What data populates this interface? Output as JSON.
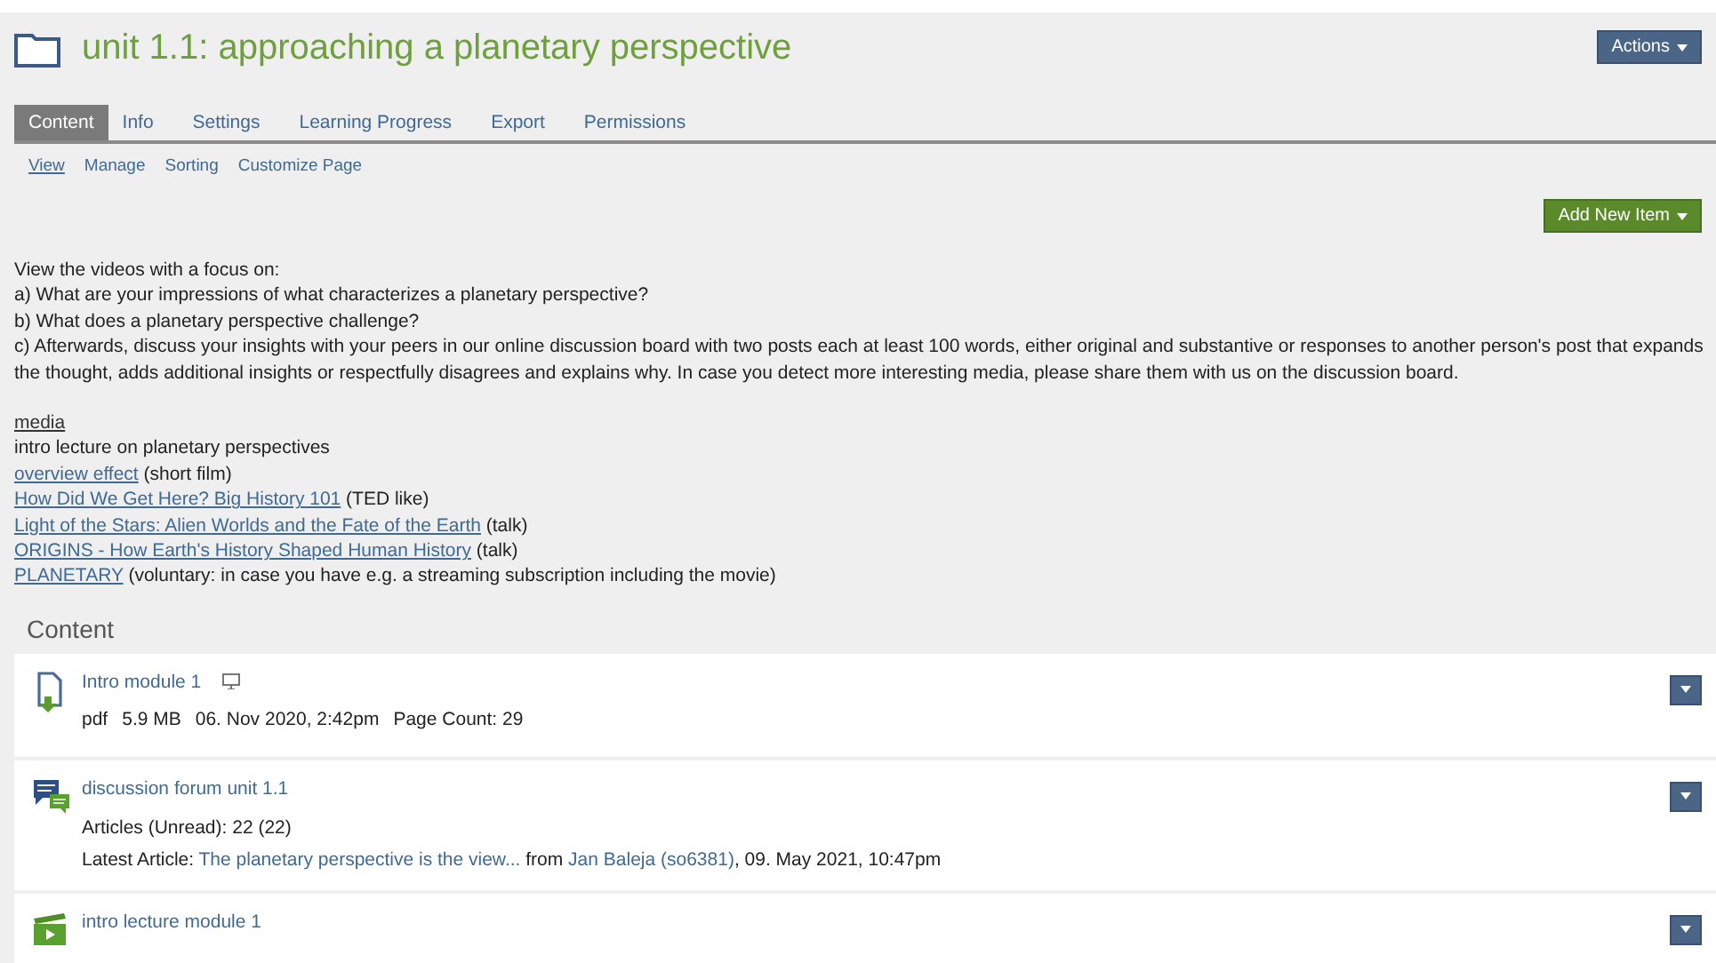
{
  "title": "unit 1.1: approaching a planetary perspective",
  "actions_button": "Actions",
  "tabs": [
    {
      "label": "Content",
      "selected": true
    },
    {
      "label": "Info",
      "selected": false
    },
    {
      "label": "Settings",
      "selected": false
    },
    {
      "label": "Learning Progress",
      "selected": false
    },
    {
      "label": "Export",
      "selected": false
    },
    {
      "label": "Permissions",
      "selected": false
    }
  ],
  "subtabs": [
    {
      "label": "View",
      "selected": true
    },
    {
      "label": "Manage",
      "selected": false
    },
    {
      "label": "Sorting",
      "selected": false
    },
    {
      "label": "Customize Page",
      "selected": false
    }
  ],
  "add_button": "Add New Item",
  "description": [
    "View the videos with a focus on:",
    "a) What are your impressions of what characterizes a planetary perspective?",
    "b) What does a planetary perspective challenge?",
    "c) Afterwards, discuss your insights with your peers in our online discussion board with two posts each at least 100 words, either original and substantive or responses to another person's post that expands the thought, adds additional insights or respectfully disagrees and explains why. In case you detect more interesting media, please share them with us on the discussion board."
  ],
  "media": {
    "heading": "media",
    "lines": [
      {
        "text": "intro lecture on planetary perspectives"
      },
      {
        "link": "overview effect",
        "text": "(short film)"
      },
      {
        "link": "How Did We Get Here? Big History 101",
        "text": "(TED like)"
      },
      {
        "link": "Light of the Stars: Alien Worlds and the Fate of the Earth",
        "text": "(talk)"
      },
      {
        "link": "ORIGINS - How Earth's History Shaped Human History",
        "text": "(talk)"
      },
      {
        "link": "PLANETARY",
        "text": "(voluntary: in case you have e.g. a streaming subscription including the movie)"
      }
    ]
  },
  "content": {
    "heading": "Content",
    "items": [
      {
        "kind": "file",
        "title": "Intro module 1",
        "properties": [
          "pdf",
          "5.9 MB",
          "06. Nov 2020, 2:42pm",
          "Page Count: 29"
        ]
      },
      {
        "kind": "forum",
        "title": "discussion forum unit 1.1",
        "lines": [
          [
            {
              "text": "Articles (Unread): 22 (22)",
              "link": false
            }
          ],
          [
            {
              "text": "Latest Article: ",
              "link": false
            },
            {
              "text": "The planetary perspective is the view...",
              "link": true
            },
            {
              "text": " from ",
              "link": false
            },
            {
              "text": "Jan Baleja (so6381)",
              "link": true
            },
            {
              "text": ", 09. May 2021, 10:47pm",
              "link": false
            }
          ]
        ]
      },
      {
        "kind": "video",
        "title": "intro lecture module 1"
      }
    ]
  }
}
